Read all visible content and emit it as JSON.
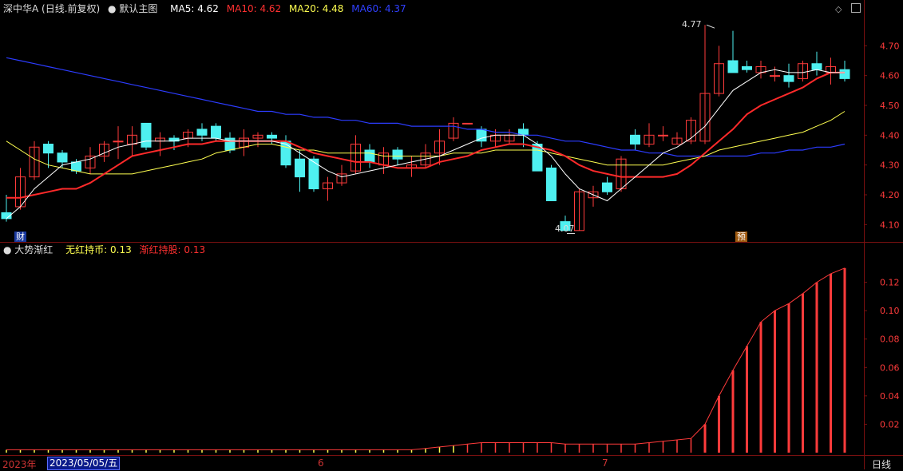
{
  "header": {
    "title": "深中华A (日线.前复权)",
    "template": "默认主图",
    "ma5_label": "MA5: 4.62",
    "ma10_label": "MA10: 4.62",
    "ma20_label": "MA20: 4.48",
    "ma60_label": "MA60: 4.37"
  },
  "sub_header": {
    "indicator": "大势渐红",
    "line1": "无红持币: 0.13",
    "line2": "渐红持股: 0.13"
  },
  "markers": {
    "cai": "财",
    "yu": "预",
    "high": "4.77",
    "low": "4.07"
  },
  "bottom": {
    "year": "2023年",
    "selected_date": "2023/05/05/五",
    "month6": "6",
    "month7": "7",
    "period": "日线"
  },
  "colors": {
    "up": "#ff3b3b",
    "down": "#4ef0f0",
    "ma5": "#ffffff",
    "ma10": "#ff2a2a",
    "ma20": "#ffff50",
    "ma60": "#2c3cff",
    "grid": "#7a1010"
  },
  "chart_data": [
    {
      "type": "candlestick",
      "ylim": [
        4.05,
        4.8
      ],
      "yticks": [
        "4.70",
        "4.60",
        "4.50",
        "4.40",
        "4.30",
        "4.20",
        "4.10"
      ],
      "candles": [
        [
          4.14,
          4.12,
          4.2,
          4.11
        ],
        [
          4.16,
          4.26,
          4.29,
          4.15
        ],
        [
          4.26,
          4.36,
          4.38,
          4.25
        ],
        [
          4.37,
          4.34,
          4.38,
          4.29
        ],
        [
          4.34,
          4.31,
          4.35,
          4.29
        ],
        [
          4.31,
          4.28,
          4.32,
          4.27
        ],
        [
          4.29,
          4.33,
          4.36,
          4.27
        ],
        [
          4.33,
          4.37,
          4.38,
          4.31
        ],
        [
          4.38,
          4.38,
          4.43,
          4.32
        ],
        [
          4.37,
          4.4,
          4.43,
          4.33
        ],
        [
          4.44,
          4.36,
          4.44,
          4.35
        ],
        [
          4.38,
          4.39,
          4.41,
          4.33
        ],
        [
          4.39,
          4.38,
          4.4,
          4.35
        ],
        [
          4.39,
          4.41,
          4.42,
          4.36
        ],
        [
          4.42,
          4.4,
          4.44,
          4.38
        ],
        [
          4.43,
          4.39,
          4.44,
          4.38
        ],
        [
          4.39,
          4.35,
          4.41,
          4.34
        ],
        [
          4.36,
          4.39,
          4.42,
          4.33
        ],
        [
          4.39,
          4.4,
          4.41,
          4.36
        ],
        [
          4.4,
          4.39,
          4.41,
          4.37
        ],
        [
          4.38,
          4.3,
          4.4,
          4.29
        ],
        [
          4.32,
          4.26,
          4.35,
          4.21
        ],
        [
          4.32,
          4.22,
          4.33,
          4.21
        ],
        [
          4.22,
          4.24,
          4.26,
          4.18
        ],
        [
          4.24,
          4.27,
          4.3,
          4.23
        ],
        [
          4.28,
          4.37,
          4.4,
          4.27
        ],
        [
          4.35,
          4.31,
          4.37,
          4.29
        ],
        [
          4.3,
          4.34,
          4.36,
          4.27
        ],
        [
          4.35,
          4.32,
          4.36,
          4.3
        ],
        [
          4.29,
          4.3,
          4.33,
          4.26
        ],
        [
          4.3,
          4.34,
          4.37,
          4.29
        ],
        [
          4.34,
          4.38,
          4.42,
          4.3
        ],
        [
          4.39,
          4.44,
          4.46,
          4.38
        ],
        [
          4.44,
          4.44,
          4.44,
          4.44
        ],
        [
          4.42,
          4.38,
          4.43,
          4.36
        ],
        [
          4.38,
          4.4,
          4.42,
          4.36
        ],
        [
          4.38,
          4.4,
          4.42,
          4.37
        ],
        [
          4.42,
          4.4,
          4.44,
          4.36
        ],
        [
          4.37,
          4.28,
          4.38,
          4.28
        ],
        [
          4.29,
          4.18,
          4.3,
          4.18
        ],
        [
          4.11,
          4.08,
          4.13,
          4.08
        ],
        [
          4.08,
          4.21,
          4.22,
          4.08
        ],
        [
          4.19,
          4.21,
          4.23,
          4.16
        ],
        [
          4.24,
          4.21,
          4.26,
          4.2
        ],
        [
          4.22,
          4.32,
          4.33,
          4.21
        ],
        [
          4.4,
          4.37,
          4.42,
          4.35
        ],
        [
          4.37,
          4.4,
          4.44,
          4.36
        ],
        [
          4.4,
          4.4,
          4.43,
          4.38
        ],
        [
          4.37,
          4.39,
          4.41,
          4.37
        ],
        [
          4.38,
          4.45,
          4.46,
          4.37
        ],
        [
          4.38,
          4.54,
          4.77,
          4.37
        ],
        [
          4.54,
          4.64,
          4.7,
          4.53
        ],
        [
          4.65,
          4.61,
          4.75,
          4.61
        ],
        [
          4.63,
          4.62,
          4.65,
          4.61
        ],
        [
          4.61,
          4.63,
          4.65,
          4.59
        ],
        [
          4.6,
          4.6,
          4.63,
          4.58
        ],
        [
          4.6,
          4.58,
          4.64,
          4.56
        ],
        [
          4.59,
          4.64,
          4.65,
          4.58
        ],
        [
          4.64,
          4.62,
          4.68,
          4.6
        ],
        [
          4.61,
          4.63,
          4.66,
          4.57
        ],
        [
          4.62,
          4.59,
          4.65,
          4.58
        ]
      ],
      "ma5": [
        4.12,
        4.16,
        4.22,
        4.26,
        4.3,
        4.31,
        4.32,
        4.34,
        4.36,
        4.37,
        4.38,
        4.38,
        4.38,
        4.39,
        4.39,
        4.39,
        4.38,
        4.38,
        4.38,
        4.38,
        4.37,
        4.34,
        4.31,
        4.28,
        4.26,
        4.27,
        4.28,
        4.29,
        4.3,
        4.31,
        4.32,
        4.33,
        4.35,
        4.37,
        4.39,
        4.4,
        4.4,
        4.4,
        4.37,
        4.33,
        4.27,
        4.22,
        4.2,
        4.18,
        4.22,
        4.26,
        4.3,
        4.34,
        4.36,
        4.39,
        4.43,
        4.49,
        4.55,
        4.58,
        4.61,
        4.62,
        4.61,
        4.61,
        4.62,
        4.61,
        4.61
      ],
      "ma10": [
        4.19,
        4.19,
        4.2,
        4.21,
        4.22,
        4.22,
        4.24,
        4.27,
        4.3,
        4.33,
        4.34,
        4.35,
        4.36,
        4.37,
        4.37,
        4.38,
        4.38,
        4.38,
        4.38,
        4.38,
        4.38,
        4.36,
        4.34,
        4.33,
        4.32,
        4.31,
        4.31,
        4.3,
        4.29,
        4.29,
        4.29,
        4.31,
        4.32,
        4.33,
        4.35,
        4.36,
        4.37,
        4.37,
        4.36,
        4.35,
        4.33,
        4.3,
        4.28,
        4.27,
        4.26,
        4.26,
        4.26,
        4.26,
        4.27,
        4.3,
        4.34,
        4.38,
        4.42,
        4.47,
        4.5,
        4.52,
        4.54,
        4.56,
        4.59,
        4.61,
        4.61
      ],
      "ma20": [
        4.38,
        4.35,
        4.32,
        4.3,
        4.29,
        4.28,
        4.27,
        4.27,
        4.27,
        4.27,
        4.28,
        4.29,
        4.3,
        4.31,
        4.32,
        4.34,
        4.35,
        4.36,
        4.37,
        4.37,
        4.36,
        4.35,
        4.35,
        4.34,
        4.34,
        4.34,
        4.34,
        4.33,
        4.33,
        4.33,
        4.33,
        4.33,
        4.34,
        4.34,
        4.34,
        4.35,
        4.35,
        4.35,
        4.35,
        4.34,
        4.33,
        4.32,
        4.31,
        4.3,
        4.3,
        4.3,
        4.3,
        4.3,
        4.31,
        4.32,
        4.33,
        4.35,
        4.36,
        4.37,
        4.38,
        4.39,
        4.4,
        4.41,
        4.43,
        4.45,
        4.48
      ],
      "ma60": [
        4.66,
        4.65,
        4.64,
        4.63,
        4.62,
        4.61,
        4.6,
        4.59,
        4.58,
        4.57,
        4.56,
        4.55,
        4.54,
        4.53,
        4.52,
        4.51,
        4.5,
        4.49,
        4.48,
        4.48,
        4.47,
        4.47,
        4.46,
        4.46,
        4.45,
        4.45,
        4.44,
        4.44,
        4.44,
        4.43,
        4.43,
        4.43,
        4.43,
        4.42,
        4.42,
        4.41,
        4.41,
        4.4,
        4.4,
        4.39,
        4.38,
        4.38,
        4.37,
        4.36,
        4.35,
        4.35,
        4.34,
        4.34,
        4.33,
        4.33,
        4.33,
        4.33,
        4.33,
        4.33,
        4.34,
        4.34,
        4.35,
        4.35,
        4.36,
        4.36,
        4.37
      ]
    },
    {
      "type": "bar",
      "ylim": [
        0,
        0.14
      ],
      "yticks": [
        "0.12",
        "0.10",
        "0.08",
        "0.06",
        "0.04",
        "0.02"
      ],
      "values": [
        0.002,
        0.002,
        0.002,
        0.002,
        0.002,
        0.002,
        0.002,
        0.002,
        0.002,
        0.002,
        0.002,
        0.002,
        0.002,
        0.002,
        0.002,
        0.002,
        0.002,
        0.002,
        0.002,
        0.002,
        0.002,
        0.002,
        0.002,
        0.002,
        0.002,
        0.002,
        0.002,
        0.002,
        0.002,
        0.002,
        0.003,
        0.004,
        0.005,
        0.006,
        0.007,
        0.007,
        0.007,
        0.007,
        0.007,
        0.007,
        0.006,
        0.006,
        0.006,
        0.006,
        0.006,
        0.006,
        0.007,
        0.008,
        0.009,
        0.01,
        0.02,
        0.04,
        0.058,
        0.075,
        0.092,
        0.1,
        0.105,
        0.112,
        0.12,
        0.126,
        0.13
      ],
      "colors_mode": "red when rising, yellow when flat/low"
    }
  ]
}
